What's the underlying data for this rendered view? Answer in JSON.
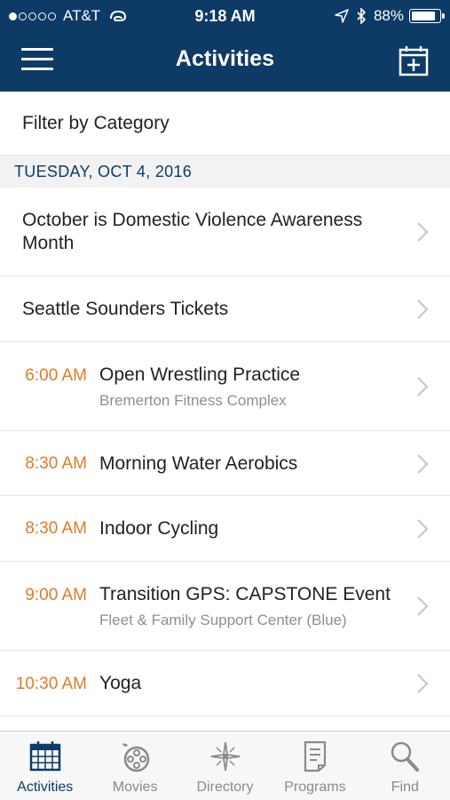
{
  "status_bar": {
    "carrier": "AT&T",
    "time": "9:18 AM",
    "battery": "88%",
    "battery_level": 0.88
  },
  "nav": {
    "title": "Activities"
  },
  "filter": {
    "label": "Filter by Category"
  },
  "date_header": "TUESDAY, OCT 4, 2016",
  "activities": [
    {
      "time": "",
      "title": "October is Domestic Violence Awareness Month",
      "subtitle": ""
    },
    {
      "time": "",
      "title": "Seattle Sounders Tickets",
      "subtitle": ""
    },
    {
      "time": "6:00 AM",
      "title": "Open Wrestling Practice",
      "subtitle": "Bremerton Fitness Complex"
    },
    {
      "time": "8:30 AM",
      "title": "Morning Water Aerobics",
      "subtitle": ""
    },
    {
      "time": "8:30 AM",
      "title": "Indoor Cycling",
      "subtitle": ""
    },
    {
      "time": "9:00 AM",
      "title": "Transition GPS: CAPSTONE Event",
      "subtitle": "Fleet & Family Support Center (Blue)"
    },
    {
      "time": "10:30 AM",
      "title": "Yoga",
      "subtitle": ""
    }
  ],
  "tabs": [
    {
      "label": "Activities",
      "icon": "calendar-icon",
      "active": true
    },
    {
      "label": "Movies",
      "icon": "film-reel-icon",
      "active": false
    },
    {
      "label": "Directory",
      "icon": "compass-icon",
      "active": false
    },
    {
      "label": "Programs",
      "icon": "document-icon",
      "active": false
    },
    {
      "label": "Find",
      "icon": "magnifier-icon",
      "active": false
    }
  ],
  "colors": {
    "header": "#0e3a66",
    "time_accent": "#e07b27",
    "subtitle": "#8e8e8e",
    "tab_active": "#0e3a66",
    "tab_inactive": "#8a8a8a"
  }
}
